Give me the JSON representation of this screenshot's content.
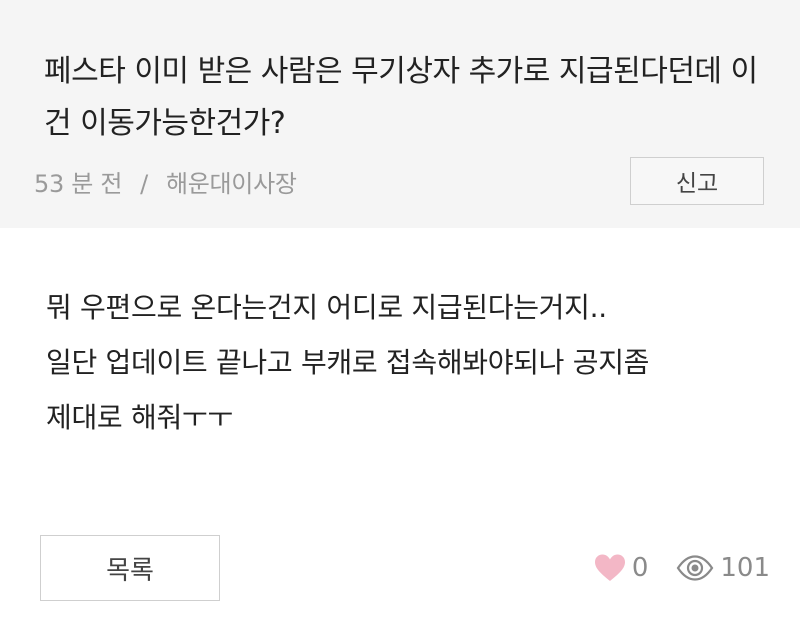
{
  "post": {
    "title": "페스타 이미 받은 사람은 무기상자 추가로 지급된다던데 이건 이동가능한건가?",
    "time": "53 분 전",
    "separator": "/",
    "author": "해운대이사장",
    "report_label": "신고",
    "body_lines": [
      "뭐 우편으로 온다는건지 어디로 지급된다는거지..",
      "일단 업데이트 끝나고 부캐로 접속해봐야되나 공지좀",
      "제대로 해줘ㅜㅜ"
    ]
  },
  "footer": {
    "list_label": "목록",
    "likes": "0",
    "views": "101",
    "icons": {
      "like": "heart-icon",
      "views": "eye-icon"
    }
  },
  "colors": {
    "header_bg": "#f5f5f5",
    "heart": "#f3b7c6",
    "muted_text": "#9a9a9a"
  }
}
